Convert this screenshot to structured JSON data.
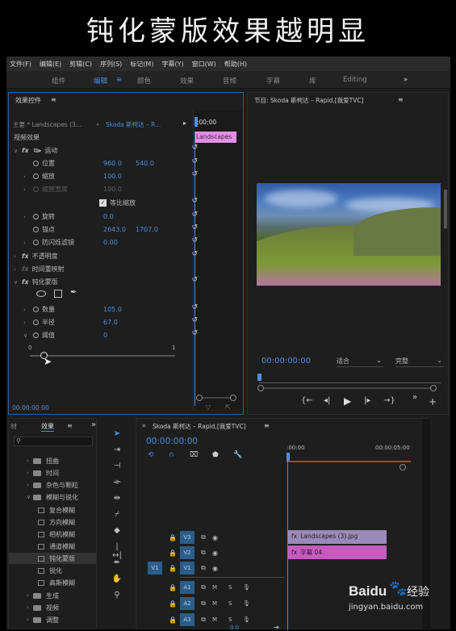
{
  "caption": "钝化蒙版效果越明显",
  "menu": [
    "文件(F)",
    "编辑(E)",
    "剪辑(C)",
    "序列(S)",
    "标记(M)",
    "字幕(Y)",
    "窗口(W)",
    "帮助(H)"
  ],
  "workspaces": [
    "组件",
    "编辑",
    "颜色",
    "效果",
    "音频",
    "字幕",
    "库",
    "Editing"
  ],
  "workspace_more": "»",
  "effect_controls": {
    "title": "效果控件",
    "menu_icon": "≡",
    "source": "主要 * Landscapes (3...",
    "sequence": "Skoda 斯柯达 – R...",
    "mini_time": ":00:00",
    "clip_label": "Landscapes",
    "section": "视频效果",
    "motion": "运动",
    "position_label": "位置",
    "position_x": "960.0",
    "position_y": "540.0",
    "scale_label": "缩放",
    "scale_value": "100.0",
    "scale_width_label": "缩放宽度",
    "scale_width_value": "100.0",
    "uniform_scale": "等比缩放",
    "rotation_label": "旋转",
    "rotation_value": "0.0",
    "anchor_label": "锚点",
    "anchor_x": "2643.0",
    "anchor_y": "1707.0",
    "antiflicker_label": "防闪烁滤镜",
    "antiflicker_value": "0.00",
    "opacity": "不透明度",
    "time_remap": "时间重映射",
    "unsharp": "钝化蒙版",
    "amount_label": "数量",
    "amount_value": "105.0",
    "radius_label": "半径",
    "radius_value": "67.0",
    "threshold_label": "阈值",
    "threshold_value": "0",
    "slider_min": "0",
    "slider_max": "1",
    "timecode": "00:00:00:00"
  },
  "program": {
    "title": "节目: Skoda 斯柯达 – Rapid,[我爱TVC]",
    "menu_icon": "≡",
    "timecode": "00:00:00:00",
    "fit": "适合",
    "quality": "完整"
  },
  "project": {
    "tab_left": "材",
    "tab": "效果",
    "menu_icon": "≡",
    "search_placeholder": "",
    "folders": [
      "扭曲",
      "时间",
      "杂色与颗粒",
      "模糊与锐化"
    ],
    "presets": [
      "复合模糊",
      "方向模糊",
      "相机模糊",
      "通道模糊",
      "钝化蒙版",
      "锐化",
      "高斯模糊"
    ],
    "folders_after": [
      "生成",
      "视频",
      "调整"
    ]
  },
  "timeline": {
    "title": "Skoda 斯柯达 – Rapid,[我爱TVC]",
    "menu_icon": "≡",
    "timecode": "00:00:00:00",
    "ruler_start": ":00:00",
    "ruler_end": "00:00:05:00",
    "tracks_video": [
      "V3",
      "V2",
      "V1"
    ],
    "tracks_audio": [
      "A1",
      "A2",
      "A3"
    ],
    "source_patch": "V1",
    "track_m": "M",
    "track_s": "S",
    "clip_v3": "Landscapes (3).jpg",
    "clip_v2": "字幕 04",
    "audio_value": "0.0"
  },
  "watermark": {
    "brand": "Baidu",
    "suffix": "经验",
    "url": "jingyan.baidu.com"
  },
  "colors": {
    "accent": "#4a8fe0",
    "clip_pink": "#c75ac0",
    "clip_purple": "#9a8ab8",
    "playhead_red": "#d63030"
  }
}
